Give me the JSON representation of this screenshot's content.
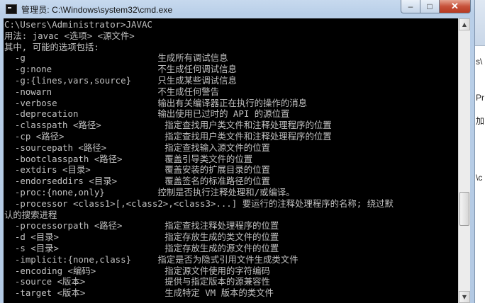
{
  "window": {
    "title": "管理员: C:\\Windows\\system32\\cmd.exe",
    "minimize_glyph": "–",
    "maximize_glyph": "□",
    "close_glyph": "✕"
  },
  "console": {
    "lines": [
      "C:\\Users\\Administrator>JAVAC",
      "用法: javac <选项> <源文件>",
      "其中, 可能的选项包括:",
      "  -g                         生成所有调试信息",
      "  -g:none                    不生成任何调试信息",
      "  -g:{lines,vars,source}     只生成某些调试信息",
      "  -nowarn                    不生成任何警告",
      "  -verbose                   输出有关编译器正在执行的操作的消息",
      "  -deprecation               输出使用已过时的 API 的源位置",
      "  -classpath <路径>            指定查找用户类文件和注释处理程序的位置",
      "  -cp <路径>                   指定查找用户类文件和注释处理程序的位置",
      "  -sourcepath <路径>           指定查找输入源文件的位置",
      "  -bootclasspath <路径>        覆盖引导类文件的位置",
      "  -extdirs <目录>              覆盖安装的扩展目录的位置",
      "  -endorseddirs <目录>         覆盖签名的标准路径的位置",
      "  -proc:{none,only}          控制是否执行注释处理和/或编译。",
      "  -processor <class1>[,<class2>,<class3>...] 要运行的注释处理程序的名称; 绕过默",
      "认的搜索进程",
      "  -processorpath <路径>        指定查找注释处理程序的位置",
      "  -d <目录>                    指定存放生成的类文件的位置",
      "  -s <目录>                    指定存放生成的源文件的位置",
      "  -implicit:{none,class}     指定是否为隐式引用文件生成类文件",
      "  -encoding <编码>             指定源文件使用的字符编码",
      "  -source <版本>               提供与指定版本的源兼容性",
      "  -target <版本>               生成特定 VM 版本的类文件"
    ]
  },
  "scrollbar": {
    "up_glyph": "▲",
    "down_glyph": "▼",
    "thumb_start_fraction": 0.62,
    "thumb_size_fraction": 0.13
  },
  "background_window": {
    "fragments": [
      "s\\",
      "Pr",
      "加",
      "\\c"
    ]
  }
}
